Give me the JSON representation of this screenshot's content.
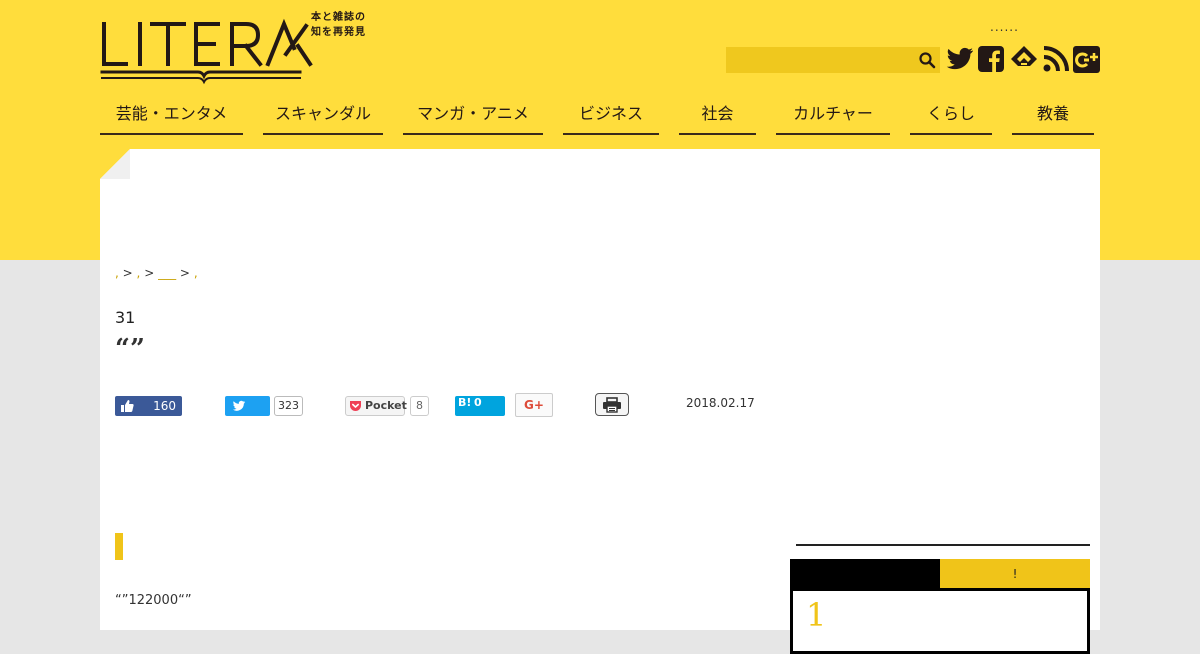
{
  "header": {
    "logo_text": "LITERA",
    "tagline_line1": "本と雑誌の",
    "tagline_line2": "知を再発見",
    "top_dots": "......",
    "search": {
      "placeholder": ""
    }
  },
  "social_icons": [
    "twitter-icon",
    "facebook-icon",
    "feedly-icon",
    "rss-icon",
    "googleplus-icon"
  ],
  "nav": {
    "items": [
      {
        "label": "芸能・エンタメ"
      },
      {
        "label": "スキャンダル"
      },
      {
        "label": "マンガ・アニメ"
      },
      {
        "label": "ビジネス"
      },
      {
        "label": "社会"
      },
      {
        "label": "カルチャー"
      },
      {
        "label": "くらし"
      },
      {
        "label": "教養"
      }
    ]
  },
  "breadcrumb": {
    "sep": ">",
    "items": [
      ",",
      ",",
      "___",
      ","
    ]
  },
  "article": {
    "title_number": "31",
    "title_quote": "“”",
    "date": "2018.02.17",
    "body_text": "“”122000“”"
  },
  "share": {
    "facebook_count": "160",
    "twitter_count": "323",
    "pocket_label": "Pocket",
    "pocket_count": "8",
    "hatena_label": "B!",
    "hatena_count": "0",
    "gplus_label": "G+"
  },
  "sidebar": {
    "tab_left_label": "",
    "tab_right_label": "!",
    "rank_first": "1"
  },
  "colors": {
    "brand_yellow": "#ffdd3c",
    "accent_yellow": "#f0c419",
    "facebook": "#3b5998",
    "twitter": "#1da1f2",
    "hatena": "#00a4de"
  }
}
